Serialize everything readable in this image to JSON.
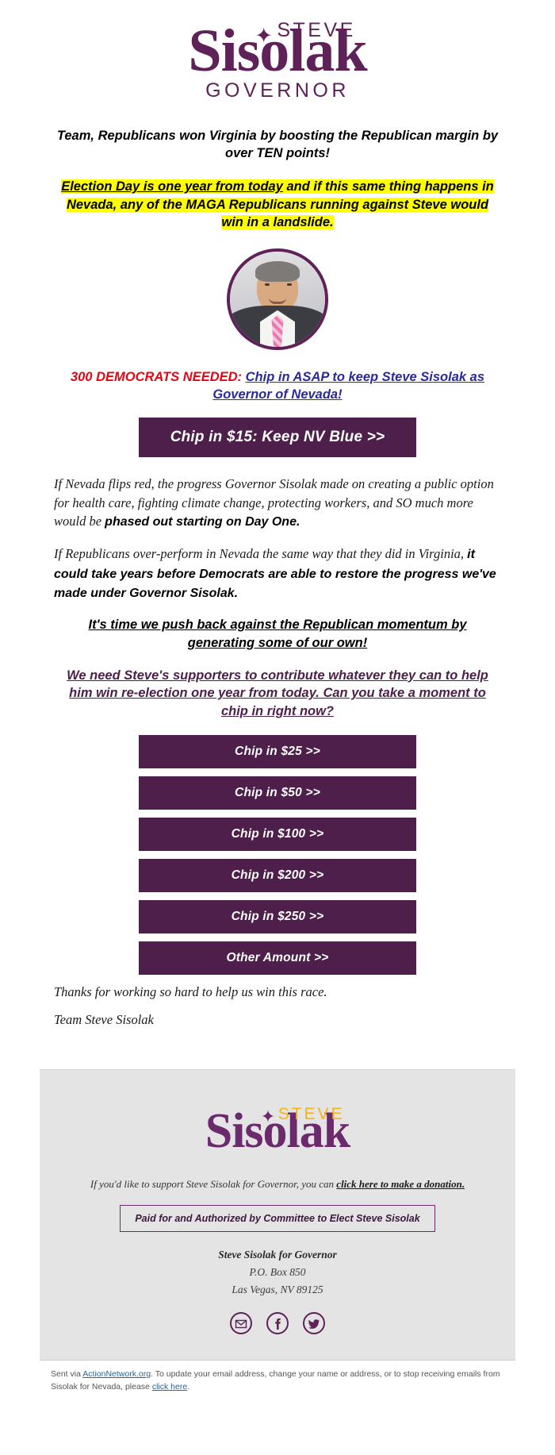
{
  "header": {
    "logo_first": "S",
    "logo_rest": "isolak",
    "logo_top": "STEVE",
    "logo_bottom": "GOVERNOR",
    "star_icon": "star-icon"
  },
  "message": {
    "headline": "Team, Republicans won Virginia by boosting the Republican margin by over TEN points!",
    "highlight_underlined": "Election Day is one year from today",
    "highlight_rest": " and if this same thing happens in Nevada, any of the MAGA Republicans running against Steve would win in a landslide.",
    "ask_red": "300 DEMOCRATS NEEDED:",
    "ask_link": "Chip in ASAP to keep Steve Sisolak as Governor of Nevada!",
    "hero_button": "Chip in $15: Keep NV Blue >>",
    "para1_a": "If Nevada flips red, the progress Governor Sisolak made on creating a public option for health care, fighting climate change, protecting workers, and SO much more would be ",
    "para1_b": "phased out starting on Day One.",
    "para2_a": "If Republicans over-perform in Nevada the same way that they did in Virginia, ",
    "para2_b": "it could take years before Democrats are able to restore the progress we've made under Governor Sisolak.",
    "emph1": "It's time we push back against the Republican momentum by generating some of our own!",
    "emph2": "We need Steve's supporters to contribute whatever they can to help him win re-election one year from today. Can you take a moment to chip in right now?",
    "thanks": "Thanks for working so hard to help us win this race.",
    "signature": "Team Steve Sisolak"
  },
  "donation_buttons": [
    {
      "label": "Chip in $25 >>"
    },
    {
      "label": "Chip in $50 >>"
    },
    {
      "label": "Chip in $100 >>"
    },
    {
      "label": "Chip in $200 >>"
    },
    {
      "label": "Chip in $250 >>"
    },
    {
      "label": "Other Amount >>"
    }
  ],
  "footer": {
    "logo_first": "S",
    "logo_rest": "isolak",
    "logo_top": "STEVE",
    "support_text": "If you'd like to support Steve Sisolak for Governor, you can ",
    "support_link": "click here to make a donation.",
    "paid_for": "Paid for and Authorized by Committee to Elect Steve Sisolak",
    "org_name": "Steve Sisolak for Governor",
    "address_line1": "P.O. Box 850",
    "address_line2": "Las Vegas, NV 89125",
    "social": [
      {
        "name": "email-icon",
        "label": "Email"
      },
      {
        "name": "facebook-icon",
        "label": "Facebook"
      },
      {
        "name": "twitter-icon",
        "label": "Twitter"
      }
    ]
  },
  "disclaimer": {
    "prefix": "Sent via ",
    "link1": "ActionNetwork.org",
    "middle": ". To update your email address, change your name or address, or to stop receiving emails from Sisolak for Nevada, please ",
    "link2": "click here",
    "suffix": "."
  },
  "colors": {
    "brand_purple": "#5e2258",
    "button_purple": "#4d1f4a",
    "highlight_yellow": "#ffff00",
    "alert_red": "#e30613",
    "link_blue": "#2a2a9c",
    "footer_gold": "#f5b317",
    "footer_bg": "#e4e4e4"
  }
}
